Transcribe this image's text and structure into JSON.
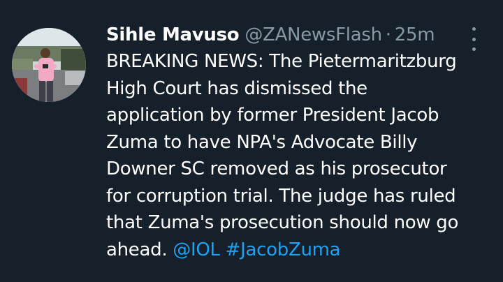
{
  "tweet": {
    "author_name": "Sihle Mavuso",
    "author_handle": "@ZANewsFlash",
    "separator": "·",
    "timestamp": "25m",
    "text_lines": [
      "BREAKING NEWS: The Pietermaritzburg",
      "High Court has dismissed the",
      "application by former President Jacob",
      "Zuma to have NPA's Advocate Billy",
      "Downer SC removed as his prosecutor",
      "for corruption trial. The judge has ruled",
      "that Zuma's prosecution should now go"
    ],
    "last_line_text": "ahead.",
    "mention": "@IOL",
    "hashtag": "#JacobZuma"
  },
  "icons": {
    "more": "more-vertical-icon",
    "avatar": "profile-photo"
  },
  "colors": {
    "background": "#15202b",
    "primary_text": "#ffffff",
    "secondary_text": "#8899a6",
    "link": "#1da1f2"
  }
}
